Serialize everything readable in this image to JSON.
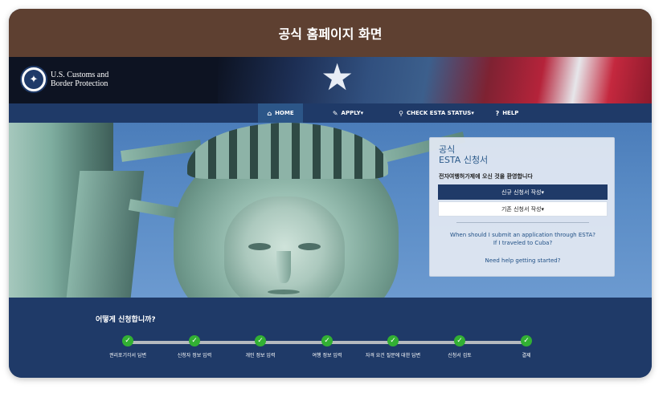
{
  "caption": "공식 홈페이지 화면",
  "agency": {
    "line1": "U.S. Customs and",
    "line2": "Border Protection"
  },
  "nav": [
    {
      "label": "HOME",
      "icon": "home-icon",
      "active": true
    },
    {
      "label": "APPLY▾",
      "icon": "pencil-icon",
      "active": false
    },
    {
      "label": "CHECK ESTA STATUS▾",
      "icon": "search-icon",
      "active": false
    },
    {
      "label": "HELP",
      "icon": "question-circle-icon",
      "active": false
    }
  ],
  "panel": {
    "title_line1": "공식",
    "title_line2": "ESTA 신청서",
    "welcome": "전자여행허가제에 오신 것을 환영합니다",
    "new_application": "신규 신청서 작성▾",
    "existing_application": "기존 신청서 작성▾",
    "link_cuba_line1": "When should I submit an application through ESTA?",
    "link_cuba_line2": "If I traveled to Cuba?",
    "link_help": "Need help getting started?"
  },
  "steps": {
    "title": "어떻게 신청합니까?",
    "items": [
      {
        "label": "권리포기각서 답변"
      },
      {
        "label": "신청자 정보 입력"
      },
      {
        "label": "개인 정보 입력"
      },
      {
        "label": "여행 정보 입력"
      },
      {
        "label": "자격 요건 질문에 대한 답변"
      },
      {
        "label": "신청서 검토"
      },
      {
        "label": "결제"
      }
    ]
  },
  "colors": {
    "caption_bg": "#5e4031",
    "nav_bg": "#1f3a68",
    "step_check": "#32b033"
  }
}
